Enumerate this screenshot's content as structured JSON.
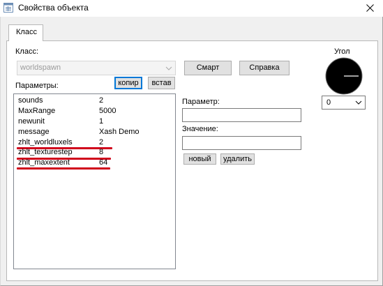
{
  "window": {
    "title": "Свойства объекта",
    "icon": "properties-window-icon",
    "close_icon": "close-icon"
  },
  "tabs": [
    {
      "label": "Класс",
      "selected": true
    }
  ],
  "class_section": {
    "label": "Класс:",
    "value": "worldspawn",
    "disabled": true
  },
  "buttons": {
    "smart": "Смарт",
    "help": "Справка",
    "copy": "копир",
    "paste": "встав",
    "new": "новый",
    "delete": "удалить"
  },
  "params_section": {
    "label": "Параметры:",
    "rows": [
      {
        "key": "sounds",
        "value": "2",
        "underlined": false
      },
      {
        "key": "MaxRange",
        "value": "5000",
        "underlined": false
      },
      {
        "key": "newunit",
        "value": "1",
        "underlined": false
      },
      {
        "key": "message",
        "value": "Xash Demo",
        "underlined": false
      },
      {
        "key": "zhlt_worldluxels",
        "value": "2",
        "underlined": true
      },
      {
        "key": "zhlt_texturestep",
        "value": "8",
        "underlined": true
      },
      {
        "key": "zhlt_maxextent",
        "value": "64",
        "underlined": true
      }
    ],
    "annotation_color": "#d0021b"
  },
  "editor": {
    "param_label": "Параметр:",
    "param_value": "",
    "value_label": "Значение:",
    "value_value": ""
  },
  "angle": {
    "label": "Угол",
    "value": "0",
    "dial_angle_deg": 0
  }
}
